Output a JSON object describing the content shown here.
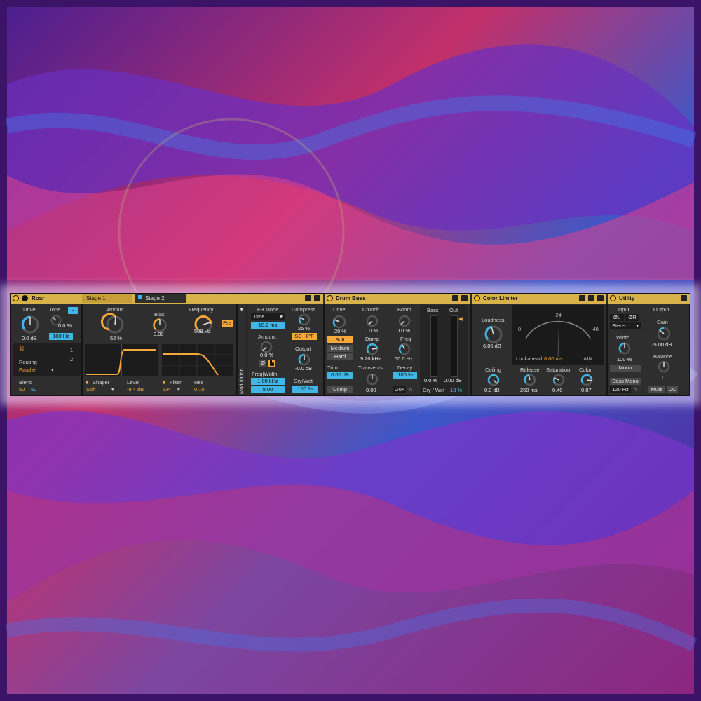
{
  "roar": {
    "title": "Roar",
    "tabs": [
      "Stage 1",
      "Stage 2"
    ],
    "drive_label": "Drive",
    "drive_value": "0.0 dB",
    "tone_label": "Tone",
    "tone_value": "0.0 %",
    "tone_freq": "180 Hz",
    "amount_label": "Amount",
    "amount_value": "52 %",
    "bias_label": "Bias",
    "bias_value": "0.00",
    "frequency_label": "Frequency",
    "frequency_value": "508 Hz",
    "pre_label": "Pre",
    "routing_label": "Routing",
    "routing_value": "Parallel",
    "blend_label": "Blend",
    "blend_a": "50",
    "blend_b": "50",
    "route_nums": [
      "1",
      "2"
    ],
    "shaper_label": "Shaper",
    "shaper_value": "Soft",
    "level_label": "Level",
    "level_value": "-9.4 dB",
    "filter_label": "Filter",
    "filter_value": "LP",
    "res_label": "Res",
    "res_value": "0.10",
    "modulation_label": "Modulation",
    "fb_mode_label": "FB Mode",
    "fb_mode_value": "Time",
    "fb_time": "18.2 ms",
    "fb_amount_label": "Amount",
    "fb_amount_value": "0.0 %",
    "fb_ab": "Ø",
    "freq_width_label": "Freq|Width",
    "freq_value": "1.00 kHz",
    "width_value": "8.00",
    "compress_label": "Compress",
    "compress_value": "25 %",
    "sc_hpf": "SC HPF",
    "output_label": "Output",
    "output_value": "-0.0 dB",
    "drywet_label": "Dry/Wet",
    "drywet_value": "100 %"
  },
  "drum_buss": {
    "title": "Drum Buss",
    "drive_label": "Drive",
    "drive_value": "20 %",
    "modes": [
      "Soft",
      "Medium",
      "Hard"
    ],
    "trim_label": "Trim",
    "trim_value": "0.00 dB",
    "comp_label": "Comp",
    "crunch_label": "Crunch",
    "crunch_value": "0.0 %",
    "damp_label": "Damp",
    "damp_value": "9.20 kHz",
    "transients_label": "Transients",
    "transients_value": "0.00",
    "boom_label": "Boom",
    "boom_value": "0.0 %",
    "freq_label": "Freq",
    "freq_value": "50.0 Hz",
    "decay_label": "Decay",
    "decay_value": "100 %",
    "g0_label": "G0+",
    "bass_label": "Bass",
    "bass_value": "0.0 %",
    "out_label": "Out",
    "out_value": "0.00 dB",
    "drywet_label": "Dry / Wet",
    "drywet_value": "13 %"
  },
  "color_limiter": {
    "title": "Color Limiter",
    "loudness_label": "Loudness",
    "loudness_value": "6.05 dB",
    "ceiling_label": "Ceiling",
    "ceiling_value": "0.0 dB",
    "meter_ticks": [
      "0",
      "-24",
      "-48"
    ],
    "lookahead_label": "Lookahead",
    "lookahead_value": "6.00 ms",
    "brand": "AIN",
    "release_label": "Release",
    "release_value": "250 ms",
    "saturation_label": "Saturation",
    "saturation_value": "0.40",
    "color_label": "Color",
    "color_value": "0.87"
  },
  "utility": {
    "title": "Utility",
    "input_label": "Input",
    "phase_l": "ØL",
    "phase_r": "ØR",
    "channel_value": "Stereo",
    "width_label": "Width",
    "width_value": "100 %",
    "mono_label": "Mono",
    "bass_mono_label": "Bass Mono",
    "bass_mono_freq": "120 Hz",
    "output_label": "Output",
    "gain_label": "Gain",
    "gain_value": "-5.00 dB",
    "balance_label": "Balance",
    "balance_value": "C",
    "mute_label": "Mute",
    "dc_label": "DC"
  }
}
